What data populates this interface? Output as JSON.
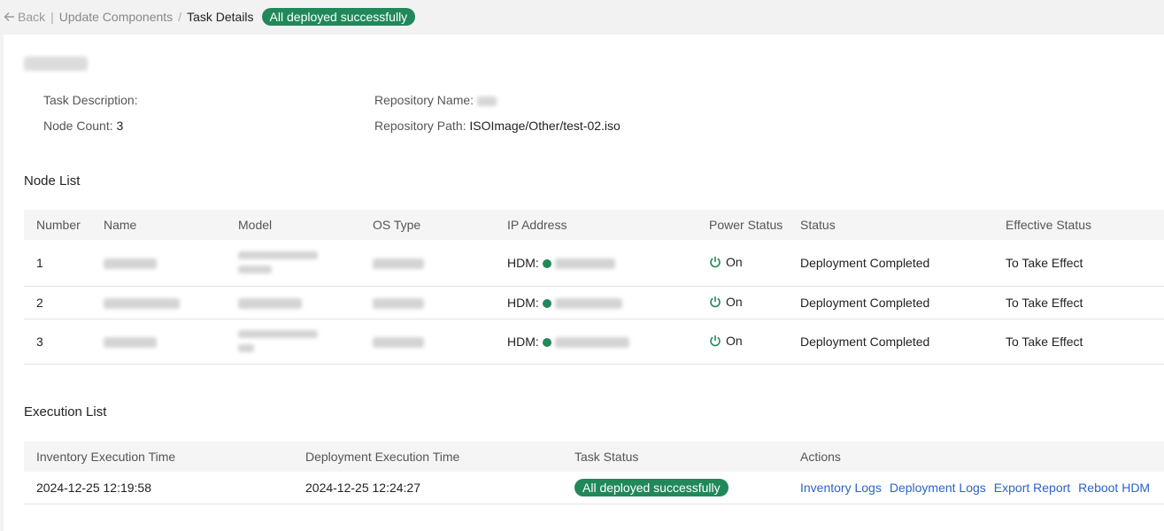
{
  "breadcrumb": {
    "back_label": "Back",
    "parent": "Update Components",
    "separator": "/",
    "current": "Task Details",
    "status_badge": "All deployed successfully"
  },
  "task_info": {
    "description_label": "Task Description:",
    "description_value": "",
    "node_count_label": "Node Count:",
    "node_count_value": "3",
    "repo_name_label": "Repository Name:",
    "repo_path_label": "Repository Path:",
    "repo_path_value": "ISOImage/Other/test-02.iso"
  },
  "node_list": {
    "title": "Node List",
    "columns": [
      "Number",
      "Name",
      "Model",
      "OS Type",
      "IP Address",
      "Power Status",
      "Status",
      "Effective Status"
    ],
    "rows": [
      {
        "number": "1",
        "ip_prefix": "HDM:",
        "power": "On",
        "status": "Deployment Completed",
        "effective": "To Take Effect"
      },
      {
        "number": "2",
        "ip_prefix": "HDM:",
        "power": "On",
        "status": "Deployment Completed",
        "effective": "To Take Effect"
      },
      {
        "number": "3",
        "ip_prefix": "HDM:",
        "power": "On",
        "status": "Deployment Completed",
        "effective": "To Take Effect"
      }
    ]
  },
  "execution_list": {
    "title": "Execution List",
    "columns": [
      "Inventory Execution Time",
      "Deployment Execution Time",
      "Task Status",
      "Actions"
    ],
    "rows": [
      {
        "inventory_time": "2024-12-25 12:19:58",
        "deployment_time": "2024-12-25 12:24:27",
        "task_status": "All deployed successfully",
        "actions": [
          "Inventory Logs",
          "Deployment Logs",
          "Export Report",
          "Reboot HDM"
        ]
      }
    ]
  },
  "colors": {
    "success": "#21885a",
    "link": "#2c63c8",
    "header_bg": "#f5f5f5"
  }
}
